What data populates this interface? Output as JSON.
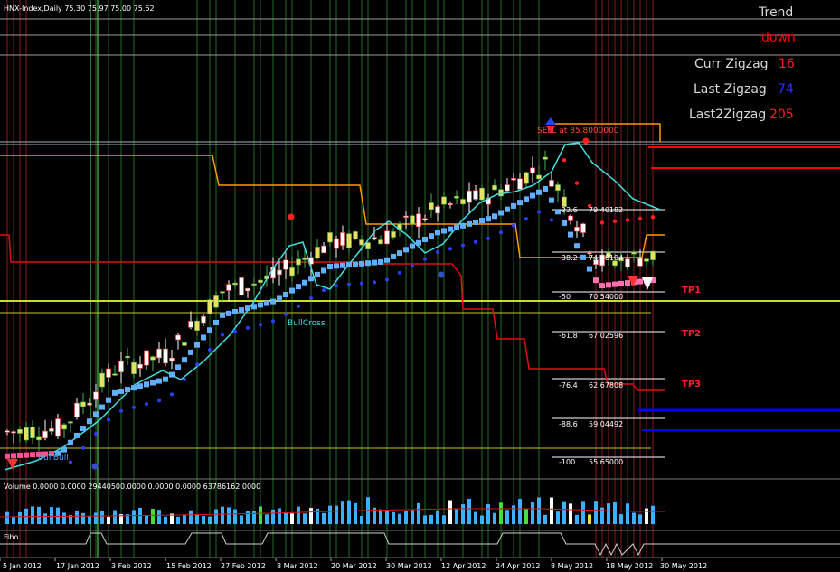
{
  "header": {
    "title": "HNX-Index,Daily  75.30 75.97 75.00 75.62"
  },
  "info_panel": {
    "trend_label": "Trend",
    "trend_value": "down",
    "curr_zigzag_label": "Curr Zigzag",
    "curr_zigzag_value": "16",
    "last_zigzag_label": "Last Zigzag",
    "last_zigzag_value": "74",
    "last2_zigzag_label": "Last2Zigzag",
    "last2_zigzag_value": "205"
  },
  "fibo_levels": [
    {
      "pct": "-23.6",
      "price": "79.40182"
    },
    {
      "pct": "-38.2",
      "price": "74.68104"
    },
    {
      "pct": "-50",
      "price": "70.54000"
    },
    {
      "pct": "-61.8",
      "price": "67.02596"
    },
    {
      "pct": "-76.4",
      "price": "62.67808"
    },
    {
      "pct": "-88.6",
      "price": "59.04492"
    },
    {
      "pct": "-100",
      "price": "55.65000"
    }
  ],
  "targets": [
    "TP1",
    "TP2",
    "TP3"
  ],
  "annotations": {
    "sell_label": "SELL at 85.8000000",
    "bull_cross": "BullCross",
    "bull_bull": "BullBull"
  },
  "volume_panel": {
    "title": "Volume 0.0000 0.0000 29440500.0000 0.0000 0.0000 63786162.0000"
  },
  "fibo_panel": {
    "title": "Fibo"
  },
  "x_axis": [
    "5 Jan 2012",
    "17 Jan 2012",
    "3 Feb 2012",
    "15 Feb 2012",
    "27 Feb 2012",
    "8 Mar 2012",
    "20 Mar 2012",
    "30 Mar 2012",
    "12 Apr 2012",
    "24 Apr 2012",
    "8 May 2012",
    "18 May 2012",
    "30 May 2012"
  ],
  "colors": {
    "background": "#000000",
    "up_candle": "#e8e060",
    "down_candle": "#ffffff",
    "trend_down": "#ff0000",
    "curr_zigzag": "#ff2020",
    "last_zigzag": "#2020ff",
    "last2_zigzag": "#ff2020",
    "cyan_ma": "#40e0e0",
    "blue_band": "#60b0ff",
    "orange_line": "#ff9900",
    "lime_line": "#c8e020"
  },
  "chart_data": {
    "type": "candlestick",
    "categories": [
      "5 Jan 2012",
      "17 Jan 2012",
      "3 Feb 2012",
      "15 Feb 2012",
      "27 Feb 2012",
      "8 Mar 2012",
      "20 Mar 2012",
      "30 Mar 2012",
      "12 Apr 2012",
      "24 Apr 2012",
      "8 May 2012",
      "18 May 2012",
      "30 May 2012"
    ],
    "close_approx": [
      57.5,
      57.8,
      64.0,
      65.5,
      72.0,
      73.5,
      77.0,
      77.5,
      80.5,
      82.0,
      85.0,
      75.0,
      75.6
    ]
  }
}
